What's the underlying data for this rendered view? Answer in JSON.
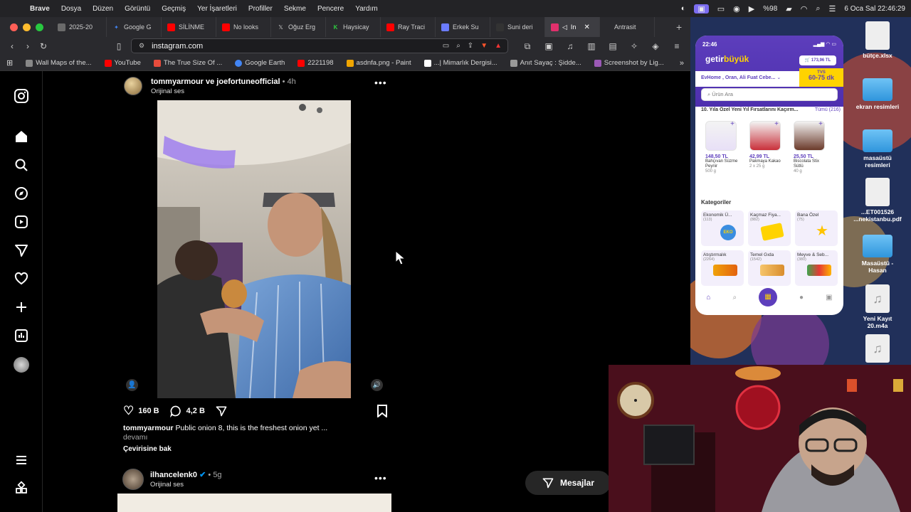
{
  "menubar": {
    "app": "Brave",
    "items": [
      "Dosya",
      "Düzen",
      "Görüntü",
      "Geçmiş",
      "Yer İşaretleri",
      "Profiller",
      "Sekme",
      "Pencere",
      "Yardım"
    ],
    "battery": "%98",
    "datetime": "6 Oca Sal  22:46:29"
  },
  "tabs": [
    {
      "label": "2025-20",
      "color": "#6a6a6a"
    },
    {
      "label": "Google G",
      "color": "#4285f4"
    },
    {
      "label": "SİLİNME",
      "color": "#ff0000"
    },
    {
      "label": "No looks",
      "color": "#ff0000"
    },
    {
      "label": "Oğuz Erg",
      "color": "#ffffff"
    },
    {
      "label": "Haysicay",
      "color": "#2ecc40"
    },
    {
      "label": "Ray Traci",
      "color": "#ff0000"
    },
    {
      "label": "Erkek Su",
      "color": "#6b7cff"
    },
    {
      "label": "Suni deri",
      "color": "#333333"
    },
    {
      "label": "In",
      "color": "#e1306c"
    },
    {
      "label": "Antrasit",
      "color": "#555555"
    }
  ],
  "toolbar": {
    "url": "instagram.com"
  },
  "bookmarks": [
    {
      "label": "Wall Maps of the...",
      "color": "#888"
    },
    {
      "label": "YouTube",
      "color": "#ff0000"
    },
    {
      "label": "The True Size Of ...",
      "color": "#e74c3c"
    },
    {
      "label": "Google Earth",
      "color": "#4285f4"
    },
    {
      "label": "2221198",
      "color": "#ff0000"
    },
    {
      "label": "asdnfa.png - Paint",
      "color": "#f0a500"
    },
    {
      "label": "...| Mimarlık Dergisi...",
      "color": "#ffffff"
    },
    {
      "label": "Anıt Sayaç : Şidde...",
      "color": "#999"
    },
    {
      "label": "Screenshot by Lig...",
      "color": "#9b59b6"
    }
  ],
  "post1": {
    "author": "tommyarmour ve joefortuneofficial",
    "time": "4h",
    "audio": "Orijinal ses",
    "likes": "160 B",
    "comments": "4,2 B",
    "caption_user": "tommyarmour",
    "caption_text": "Public onion 8, this is the freshest onion yet ...",
    "more": "devamı",
    "translate": "Çevirisine bak"
  },
  "post2": {
    "author": "ilhancelenk0",
    "time": "5g",
    "audio": "Orijinal ses"
  },
  "messages_button": "Mesajlar",
  "desktop_icons": [
    {
      "label": "bütçe.xlsx",
      "type": "file"
    },
    {
      "label": "ekran resimleri",
      "type": "folder"
    },
    {
      "label": "masaüstü resimleri",
      "type": "folder"
    },
    {
      "label": "...ET001526 ...nekistanbu.pdf",
      "type": "file"
    },
    {
      "label": "Masaüstü - Hasan",
      "type": "folder"
    },
    {
      "label": "Yeni Kayıt 20.m4a",
      "type": "file"
    },
    {
      "label": "",
      "type": "file"
    }
  ],
  "phone": {
    "time": "22:46",
    "brand_a": "getir",
    "brand_b": "büyük",
    "cart": "173,96 TL",
    "address": "EvHome , Oran, Ali Fuat Cebe...",
    "eta_label": "TVS",
    "eta": "60-75 dk",
    "search_placeholder": "Ürün Ara",
    "campaign": "10. Yıla Özel Yeni Yıl Fırsatlarını Kaçırm...",
    "campaign_all": "Tümü (216)",
    "products": [
      {
        "price": "148,50 TL",
        "name": "Bahçıvan Süzme Peynir",
        "size": "500 g"
      },
      {
        "price": "42,99 TL",
        "name": "Pakmaya Kakao",
        "size": "2 x 25 g"
      },
      {
        "price": "25,50 TL",
        "name": "Biscolata Stix Sütlü",
        "size": "40 g"
      }
    ],
    "categories_title": "Kategoriler",
    "categories": [
      {
        "name": "Ekonomik Ü...",
        "count": "(113)"
      },
      {
        "name": "Kaçmaz Fiya...",
        "count": "(882)"
      },
      {
        "name": "Bana Özel",
        "count": "(75)"
      },
      {
        "name": "Atıştırmalık",
        "count": "(2264)"
      },
      {
        "name": "Temel Gıda",
        "count": "(1542)"
      },
      {
        "name": "Meyve & Seb...",
        "count": "(380)"
      }
    ]
  }
}
